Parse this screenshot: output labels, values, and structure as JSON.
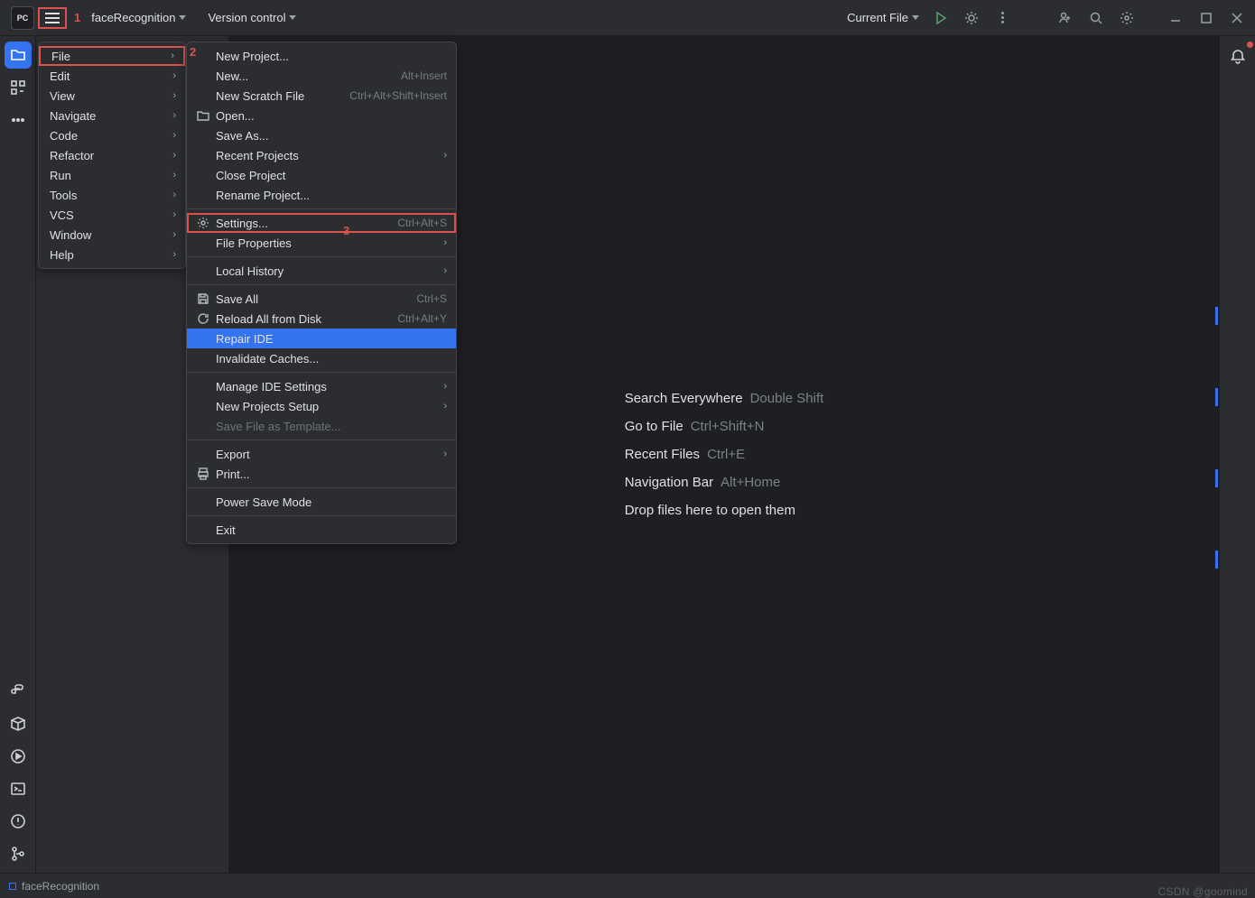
{
  "titlebar": {
    "project": "faceRecognition",
    "vc_label": "Version control",
    "run_config": "Current File",
    "annotation1": "1"
  },
  "main_menu": {
    "items": [
      {
        "label": "File",
        "submenu": true,
        "highlighted": true
      },
      {
        "label": "Edit",
        "submenu": true
      },
      {
        "label": "View",
        "submenu": true
      },
      {
        "label": "Navigate",
        "submenu": true
      },
      {
        "label": "Code",
        "submenu": true
      },
      {
        "label": "Refactor",
        "submenu": true
      },
      {
        "label": "Run",
        "submenu": true
      },
      {
        "label": "Tools",
        "submenu": true
      },
      {
        "label": "VCS",
        "submenu": true
      },
      {
        "label": "Window",
        "submenu": true
      },
      {
        "label": "Help",
        "submenu": true
      }
    ],
    "annotation2": "2"
  },
  "file_menu": {
    "annotation3": "3",
    "items_new_project": "New Project...",
    "items_new": "New...",
    "items_new_shortcut": "Alt+Insert",
    "items_new_scratch": "New Scratch File",
    "items_new_scratch_shortcut": "Ctrl+Alt+Shift+Insert",
    "items_open": "Open...",
    "items_save_as": "Save As...",
    "items_recent": "Recent Projects",
    "items_close": "Close Project",
    "items_rename": "Rename Project...",
    "items_settings": "Settings...",
    "items_settings_shortcut": "Ctrl+Alt+S",
    "items_file_props": "File Properties",
    "items_local_hist": "Local History",
    "items_save_all": "Save All",
    "items_save_all_shortcut": "Ctrl+S",
    "items_reload": "Reload All from Disk",
    "items_reload_shortcut": "Ctrl+Alt+Y",
    "items_repair": "Repair IDE",
    "items_invalidate": "Invalidate Caches...",
    "items_manage_ide": "Manage IDE Settings",
    "items_new_proj_setup": "New Projects Setup",
    "items_save_template": "Save File as Template...",
    "items_export": "Export",
    "items_print": "Print...",
    "items_power_save": "Power Save Mode",
    "items_exit": "Exit"
  },
  "welcome": {
    "l1": "Search Everywhere",
    "s1": "Double Shift",
    "l2": "Go to File",
    "s2": "Ctrl+Shift+N",
    "l3": "Recent Files",
    "s3": "Ctrl+E",
    "l4": "Navigation Bar",
    "s4": "Alt+Home",
    "l5": "Drop files here to open them"
  },
  "statusbar": {
    "project": "faceRecognition",
    "watermark": "CSDN @goomind"
  }
}
